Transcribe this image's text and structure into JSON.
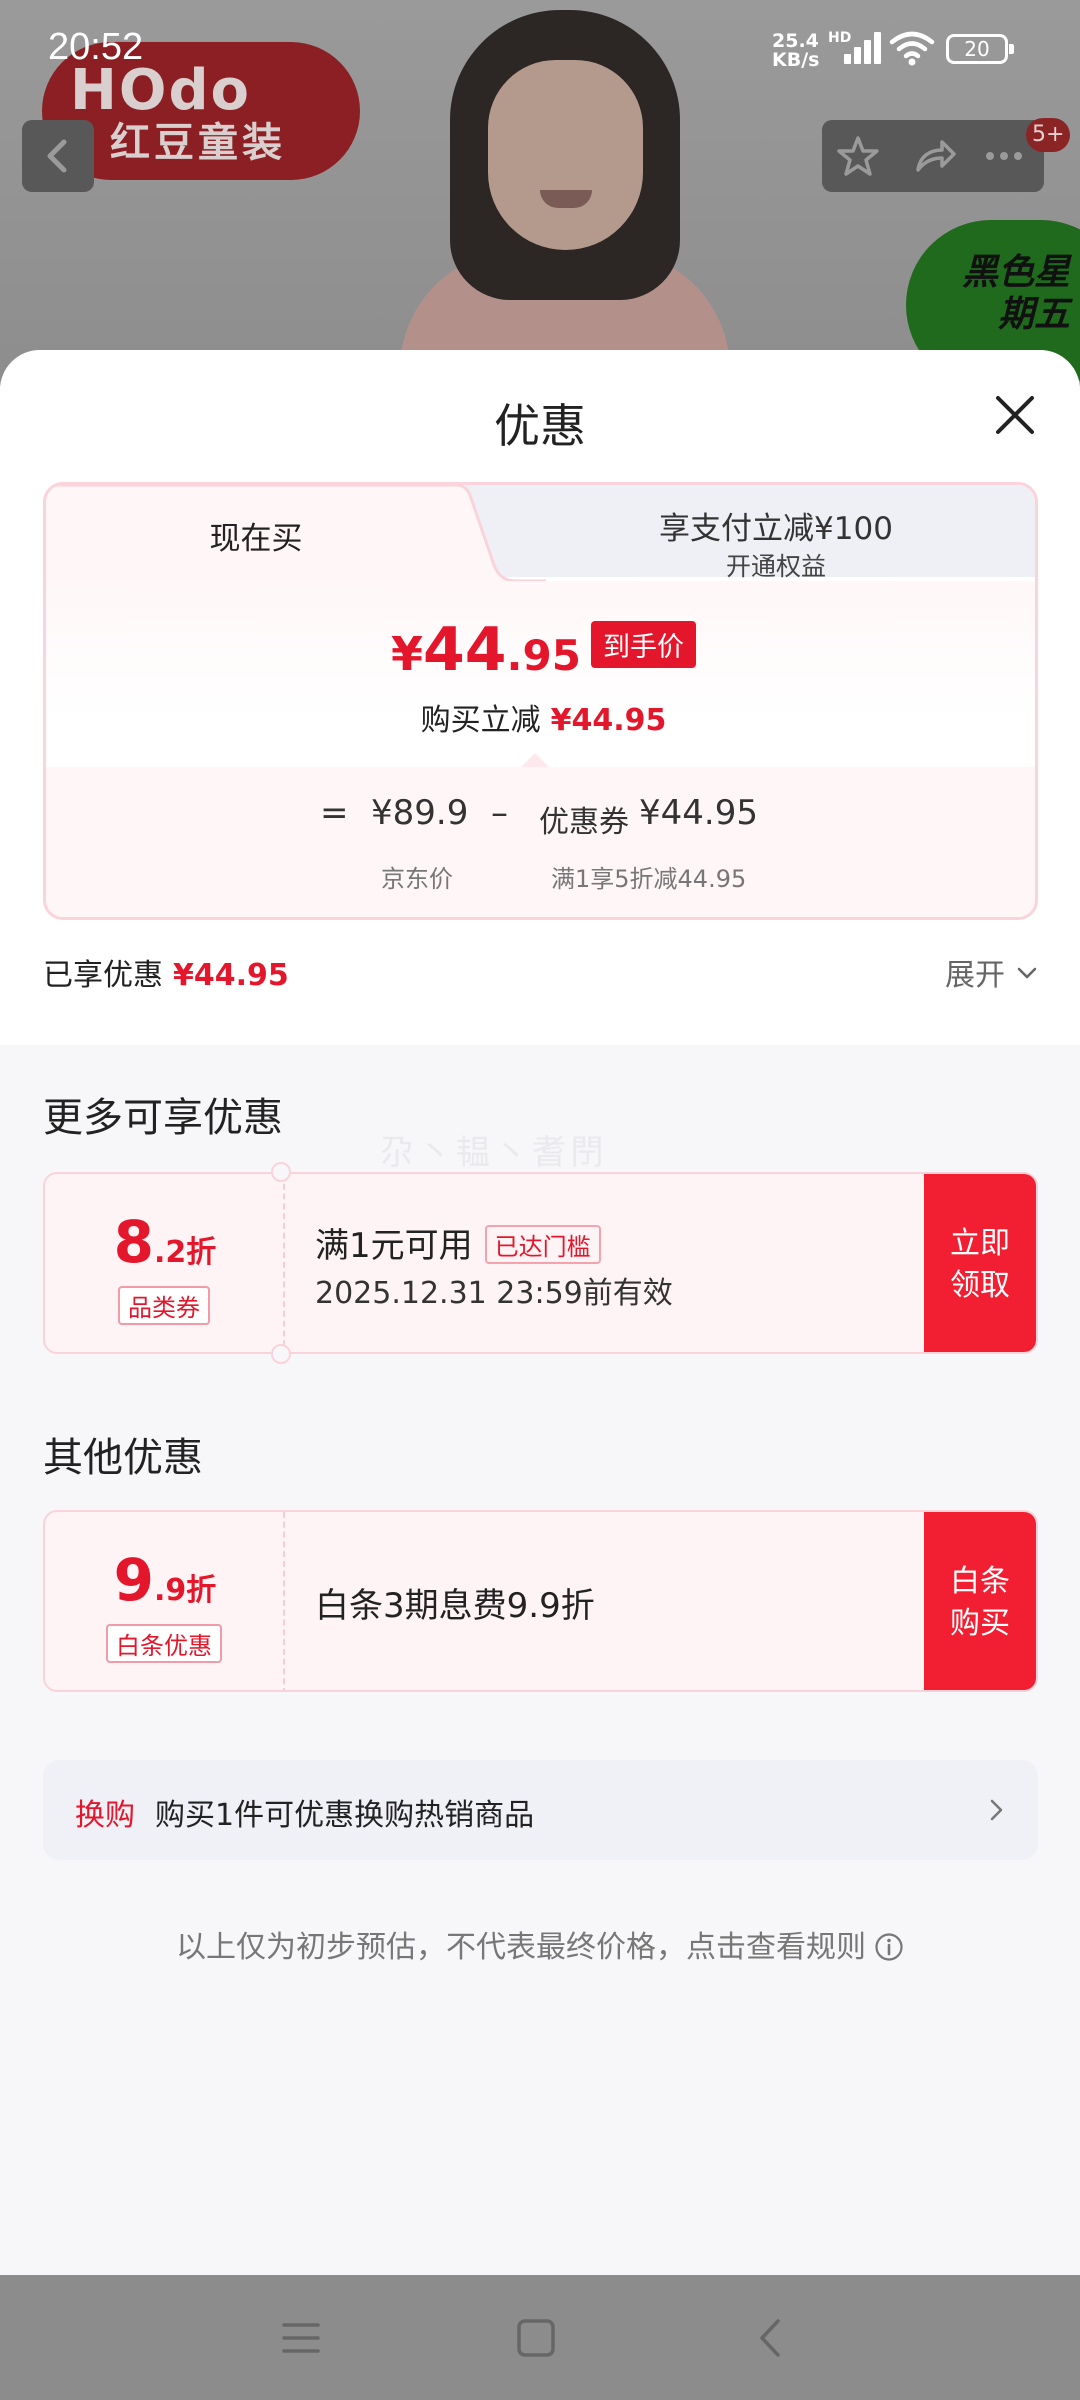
{
  "status_bar": {
    "time": "20:52",
    "net_speed_top": "25.4",
    "net_speed_bottom": "KB/s",
    "network_type": "HD",
    "battery": "20"
  },
  "background_page": {
    "brand_en": "HOdo",
    "brand_cn": "红豆童装",
    "cart_badge": "5+",
    "promo_text": "黑色星期五",
    "icons": [
      "back-icon",
      "star-icon",
      "share-icon",
      "more-icon"
    ]
  },
  "sheet": {
    "title": "优惠",
    "tabs": {
      "now": "现在买",
      "pay_title": "享支付立减¥100",
      "pay_sub": "开通权益"
    },
    "price": {
      "currency": "¥",
      "integer": "44",
      "decimal": ".95",
      "tag": "到手价",
      "reduce_label": "购买立减",
      "reduce_value": "¥44.95"
    },
    "calc": {
      "equals": "=",
      "jd_price": "¥89.9",
      "minus": "–",
      "coupon_label": "优惠券",
      "coupon_value": "¥44.95",
      "jd_price_label": "京东价",
      "coupon_rule": "满1享5折减44.95"
    },
    "enjoyed_label": "已享优惠",
    "enjoyed_value": "¥44.95",
    "expand_label": "展开",
    "more_section": {
      "title": "更多可享优惠",
      "watermark": "尕丶韫丶耆閅",
      "coupon": {
        "discount_int": "8",
        "discount_dec": ".2折",
        "tag": "品类券",
        "condition": "满1元可用",
        "reached": "已达门槛",
        "validity": "2025.12.31 23:59前有效",
        "button": "立即领取"
      }
    },
    "other_section": {
      "title": "其他优惠",
      "baitiao": {
        "discount_int": "9",
        "discount_dec": ".9折",
        "tag": "白条优惠",
        "text": "白条3期息费9.9折",
        "button": "白条购买"
      }
    },
    "swap": {
      "tag": "换购",
      "text": "购买1件可优惠换购热销商品"
    },
    "disclaimer": "以上仅为初步预估，不代表最终价格，点击查看规则"
  },
  "colors": {
    "accent_red": "#e4162b",
    "button_red": "#f21f33"
  }
}
